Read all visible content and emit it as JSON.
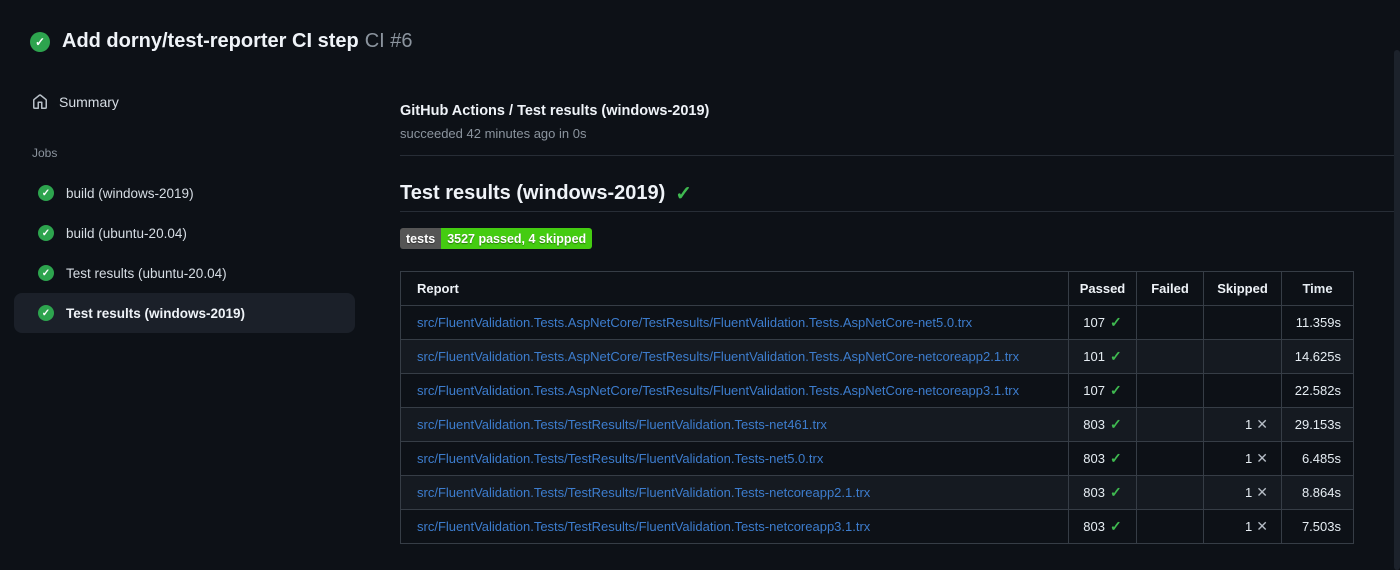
{
  "header": {
    "title": "Add dorny/test-reporter CI step",
    "run_number": "CI #6"
  },
  "sidebar": {
    "summary_label": "Summary",
    "jobs_label": "Jobs",
    "jobs": [
      {
        "label": "build (windows-2019)",
        "status": "success",
        "selected": false
      },
      {
        "label": "build (ubuntu-20.04)",
        "status": "success",
        "selected": false
      },
      {
        "label": "Test results (ubuntu-20.04)",
        "status": "success",
        "selected": false
      },
      {
        "label": "Test results (windows-2019)",
        "status": "success",
        "selected": true
      }
    ]
  },
  "main": {
    "check_title": "GitHub Actions / Test results (windows-2019)",
    "check_status": "succeeded 42 minutes ago in 0s",
    "section_title": "Test results (windows-2019)",
    "badge": {
      "label": "tests",
      "value": "3527 passed, 4 skipped"
    },
    "table": {
      "headers": [
        "Report",
        "Passed",
        "Failed",
        "Skipped",
        "Time"
      ],
      "rows": [
        {
          "report": "src/FluentValidation.Tests.AspNetCore/TestResults/FluentValidation.Tests.AspNetCore-net5.0.trx",
          "passed": "107",
          "failed": "",
          "skipped": "",
          "time": "11.359s"
        },
        {
          "report": "src/FluentValidation.Tests.AspNetCore/TestResults/FluentValidation.Tests.AspNetCore-netcoreapp2.1.trx",
          "passed": "101",
          "failed": "",
          "skipped": "",
          "time": "14.625s"
        },
        {
          "report": "src/FluentValidation.Tests.AspNetCore/TestResults/FluentValidation.Tests.AspNetCore-netcoreapp3.1.trx",
          "passed": "107",
          "failed": "",
          "skipped": "",
          "time": "22.582s"
        },
        {
          "report": "src/FluentValidation.Tests/TestResults/FluentValidation.Tests-net461.trx",
          "passed": "803",
          "failed": "",
          "skipped": "1",
          "time": "29.153s"
        },
        {
          "report": "src/FluentValidation.Tests/TestResults/FluentValidation.Tests-net5.0.trx",
          "passed": "803",
          "failed": "",
          "skipped": "1",
          "time": "6.485s"
        },
        {
          "report": "src/FluentValidation.Tests/TestResults/FluentValidation.Tests-netcoreapp2.1.trx",
          "passed": "803",
          "failed": "",
          "skipped": "1",
          "time": "8.864s"
        },
        {
          "report": "src/FluentValidation.Tests/TestResults/FluentValidation.Tests-netcoreapp3.1.trx",
          "passed": "803",
          "failed": "",
          "skipped": "1",
          "time": "7.503s"
        }
      ]
    }
  },
  "icons": {
    "status_check": "✓",
    "passed_check": "✓",
    "skipped_cross": "✕",
    "title_check": "✓"
  },
  "colors": {
    "background": "#0d1117",
    "success_circle": "#2da44e",
    "success_check": "#3fb950",
    "link_blue": "#3d7dce",
    "badge_label_bg": "#555555",
    "badge_value_bg": "#44cc11",
    "selected_item_bg": "#1b2029",
    "alt_row_bg": "#151a21",
    "secondary_text": "#8b949e"
  }
}
